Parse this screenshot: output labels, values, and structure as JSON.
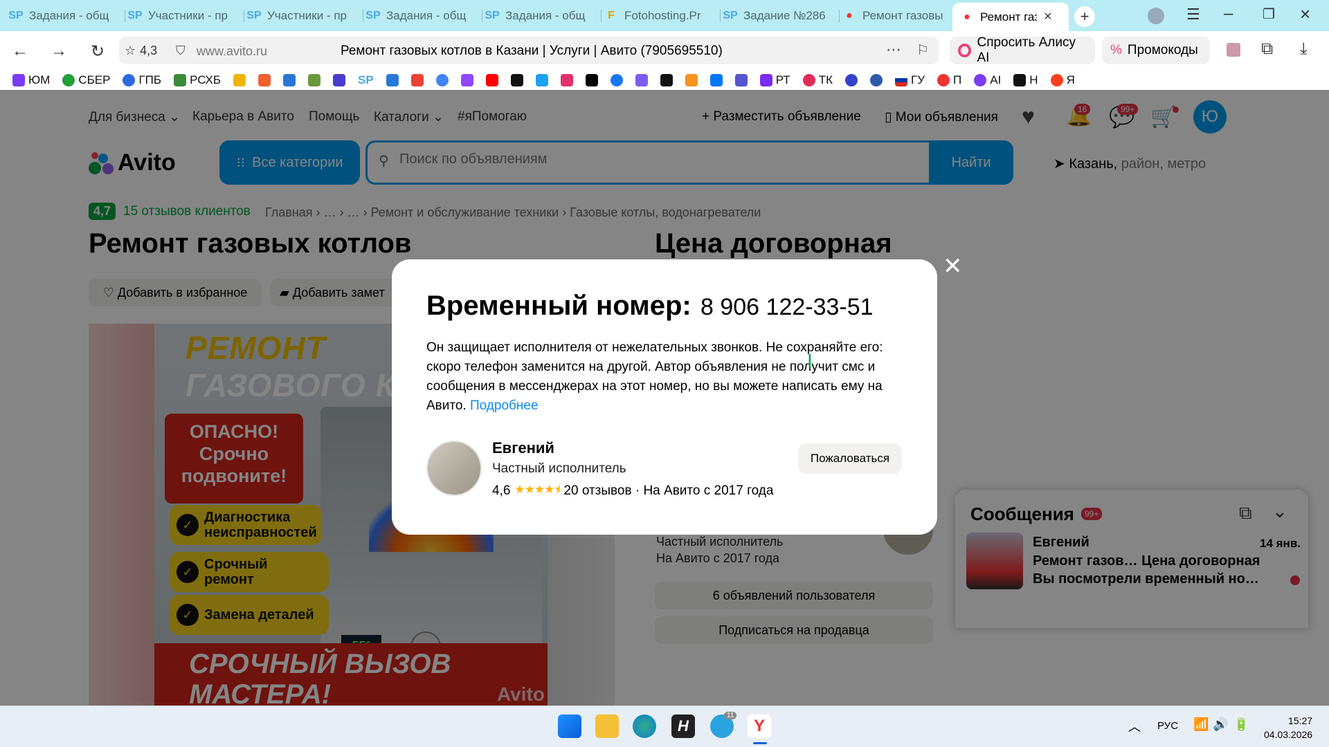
{
  "browser": {
    "tabs": [
      {
        "label": "Задания - общ"
      },
      {
        "label": "Участники - пр"
      },
      {
        "label": "Участники - пр"
      },
      {
        "label": "Задания - общ"
      },
      {
        "label": "Задания - общ"
      },
      {
        "label": "Fotohosting.Pr"
      },
      {
        "label": "Задание №286"
      },
      {
        "label": "Ремонт газовы"
      },
      {
        "label": "Ремонт газо"
      }
    ],
    "rating": "4,3",
    "url": "www.avito.ru",
    "page_title": "Ремонт газовых котлов в Казани | Услуги | Авито (7905695510)",
    "alice": "Спросить Алису AI",
    "promo": "Промокоды",
    "bookmarks": [
      "ЮМ",
      "СБЕР",
      "ГПБ",
      "РСХБ",
      "SP",
      "РТ",
      "ТК",
      "ГУ",
      "П",
      "AI",
      "Н",
      "Я"
    ]
  },
  "site": {
    "nav": [
      "Для бизнеса",
      "Карьера в Авито",
      "Помощь",
      "Каталоги",
      "#яПомогаю"
    ],
    "post_ad": "Разместить объявление",
    "my_ads": "Мои объявления",
    "notif_count": "16",
    "msg_count": "99+",
    "avatar_letter": "Ю",
    "logo": "Avito",
    "categories_btn": "Все категории",
    "search_placeholder": "Поиск по объявлениям",
    "search_btn": "Найти",
    "city": "Казань,",
    "city_hint": " район, метро",
    "rating": "4,7",
    "reviews": "15 отзывов клиентов",
    "breadcrumb": "Главная  ›  …  ›  …  ›  Ремонт и обслуживание техники  ›  Газовые котлы, водонагреватели",
    "title": "Ремонт газовых котлов",
    "price": "Цена договорная",
    "add_fav": "Добавить в избранное",
    "add_note": "Добавить замет",
    "poster": {
      "line1": "РЕМОНТ",
      "line2": "ГАЗОВОГО К",
      "danger": "ОПАСНО! Срочно подвоните!",
      "checks": [
        "Диагностика неисправностей",
        "Срочный ремонт",
        "Замена деталей"
      ],
      "display": "55°",
      "call1": "СРОЧНЫЙ ВЫЗОВ",
      "call2": "МАСТЕРА!",
      "watermark": "Avito"
    },
    "seller_type": "Частный исполнитель",
    "seller_since": "На Авито с 2017 года",
    "user_ads": "6 объявлений пользователя",
    "subscribe": "Подписаться на продавца"
  },
  "chat": {
    "title": "Сообщения",
    "badge": "99+",
    "item": {
      "name": "Евгений",
      "date": "14 янв.",
      "subject": "Ремонт газов… Цена договорная",
      "preview": "Вы посмотрели временный но…"
    }
  },
  "modal": {
    "title": "Временный номер:",
    "phone": "8 906 122-33-51",
    "desc": "Он защищает исполнителя от нежелательных звонков. Не сохраняйте его: скоро телефон заменится на другой. Автор объявления не получит смс и сообщения в мессенджерах на этот номер, но вы можете написать ему на Авито. ",
    "more": "Подробнее",
    "name": "Евгений",
    "type": "Частный исполнитель",
    "rating": "4,6",
    "reviews": "20 отзывов · На Авито с 2017 года",
    "complain": "Пожаловаться"
  },
  "taskbar": {
    "lang": "РУС",
    "time": "15:27",
    "date": "04.03.2026",
    "telegram_badge": "11"
  },
  "colors": {
    "avito_blue": "#009cf0",
    "green": "#04a541",
    "tab_bg": "#b9ecf4"
  }
}
